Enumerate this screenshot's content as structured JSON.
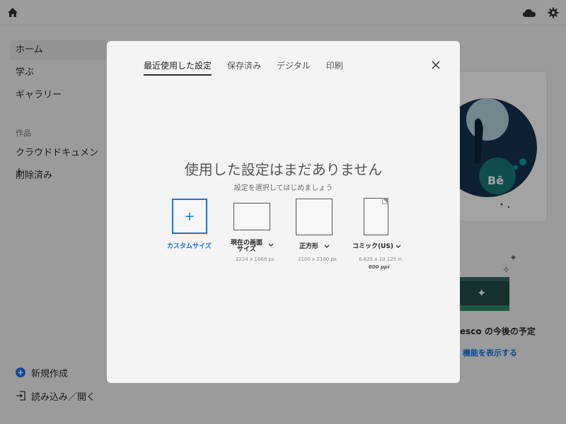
{
  "sidebar": {
    "items": [
      {
        "label": "ホーム"
      },
      {
        "label": "学ぶ"
      },
      {
        "label": "ギャラリー"
      }
    ],
    "section_label": "作品",
    "work_items": [
      {
        "label": "クラウドドキュメント"
      },
      {
        "label": "削除済み"
      }
    ],
    "new_label": "新規作成",
    "import_label": "読み込み／開く"
  },
  "background": {
    "future_title": "esco の今後の予定",
    "future_link": "機能を表示する",
    "behance_label": "Bē"
  },
  "modal": {
    "tabs": [
      {
        "label": "最近使用した設定"
      },
      {
        "label": "保存済み"
      },
      {
        "label": "デジタル"
      },
      {
        "label": "印刷"
      }
    ],
    "empty_title": "使用した設定はまだありません",
    "empty_subtitle": "設定を選択してはじめましょう",
    "presets": [
      {
        "label": "カスタムサイズ",
        "plus": "+"
      },
      {
        "label_line1": "現在の画面",
        "label_line2": "サイズ",
        "dims": "2224 x 1668 px"
      },
      {
        "label": "正方形",
        "dims": "2100 x 2100 px"
      },
      {
        "label": "コミック(US)",
        "dims": "6.625 x 10.125 in",
        "ppi": "600 ppi"
      }
    ]
  },
  "colors": {
    "accent": "#1473e6"
  }
}
